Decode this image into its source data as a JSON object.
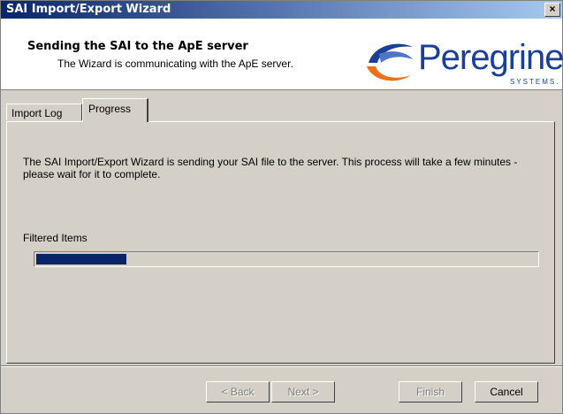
{
  "window": {
    "title": "SAI Import/Export Wizard",
    "close_label": "×"
  },
  "header": {
    "title": "Sending the SAI to the ApE server",
    "subtitle": "The Wizard is communicating with the ApE server.",
    "logo_word": "Peregrine",
    "logo_sub": "SYSTEMS."
  },
  "tabs": [
    {
      "label": "Import Log",
      "active": false
    },
    {
      "label": "Progress",
      "active": true
    }
  ],
  "panel": {
    "message": "The SAI Import/Export Wizard is sending your SAI file to the server.  This process will take a few minutes - please wait for it to complete.",
    "progress_label": "Filtered Items",
    "progress_fraction": 0.18
  },
  "buttons": {
    "back": "< Back",
    "next": "Next >",
    "finish": "Finish",
    "cancel": "Cancel"
  },
  "colors": {
    "title_bar": "#0a246a",
    "progress_fill": "#0a246a",
    "logo": "#1b3f97",
    "logo_accent": "#e8731a"
  }
}
